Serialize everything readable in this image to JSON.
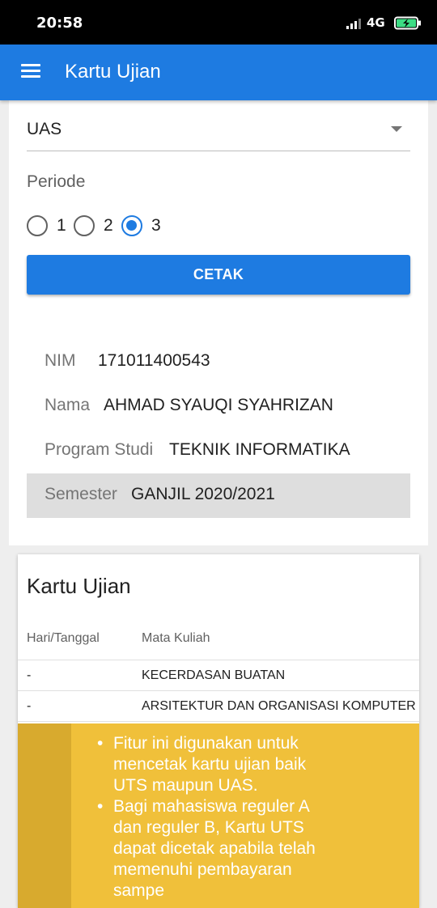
{
  "status_bar": {
    "time": "20:58",
    "network": "4G",
    "icons": [
      "signal-icon",
      "battery-charging-icon"
    ]
  },
  "app_bar": {
    "title": "Kartu Ujian",
    "menu_icon": "hamburger-menu-icon"
  },
  "form": {
    "exam_type": {
      "selected": "UAS"
    },
    "periode": {
      "label": "Periode",
      "options": [
        "1",
        "2",
        "3"
      ],
      "selected": "3"
    },
    "print_button": "CETAK"
  },
  "student": {
    "nim": {
      "label": "NIM",
      "value": "171011400543"
    },
    "nama": {
      "label": "Nama",
      "value": "AHMAD SYAUQI SYAHRIZAN"
    },
    "program_studi": {
      "label": "Program Studi",
      "value": "TEKNIK INFORMATIKA"
    },
    "semester": {
      "label": "Semester",
      "value": "GANJIL 2020/2021"
    }
  },
  "exam_card": {
    "title": "Kartu Ujian",
    "columns": [
      "Hari/Tanggal",
      "Mata Kuliah"
    ],
    "rows": [
      {
        "date": "-",
        "course": "KECERDASAN BUATAN"
      },
      {
        "date": "-",
        "course": "ARSITEKTUR DAN ORGANISASI KOMPUTER"
      }
    ]
  },
  "notice": {
    "items": [
      "Fitur ini digunakan untuk mencetak kartu ujian baik UTS maupun UAS.",
      "Bagi mahasiswa reguler A dan reguler B, Kartu UTS dapat dicetak apabila telah memenuhi pembayaran sampe"
    ]
  },
  "colors": {
    "primary": "#1e7be1",
    "notice_bg": "#f0c03a",
    "notice_strip": "#d8aa2e",
    "semester_row_bg": "#dedede"
  }
}
